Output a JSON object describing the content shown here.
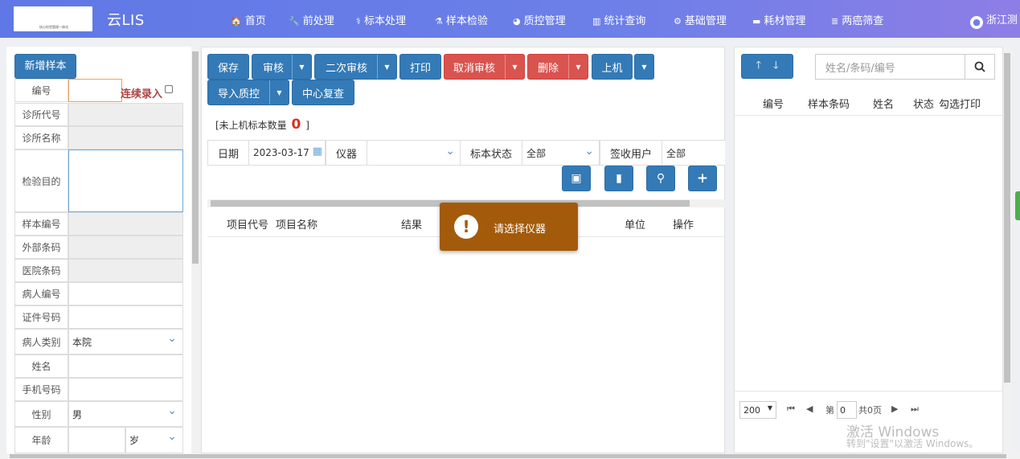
{
  "header": {
    "logo_text": "核心检验管理一体化",
    "app_title": "云LIS",
    "nav": [
      {
        "icon": "home-icon",
        "glyph": "🏠",
        "label": "首页"
      },
      {
        "icon": "wrench-icon",
        "glyph": "🔧",
        "label": "前处理"
      },
      {
        "icon": "stethoscope-icon",
        "glyph": "⚕",
        "label": "标本处理"
      },
      {
        "icon": "flask-icon",
        "glyph": "⚗",
        "label": "样本检验"
      },
      {
        "icon": "pie-chart-icon",
        "glyph": "◕",
        "label": "质控管理"
      },
      {
        "icon": "bar-chart-icon",
        "glyph": "▥",
        "label": "统计查询"
      },
      {
        "icon": "gear-icon",
        "glyph": "⚙",
        "label": "基础管理"
      },
      {
        "icon": "briefcase-icon",
        "glyph": "▬",
        "label": "耗材管理"
      },
      {
        "icon": "list-icon",
        "glyph": "≣",
        "label": "两癌筛查"
      }
    ],
    "user_label": "浙江测"
  },
  "left": {
    "new_sample": "新增样本",
    "continuous_entry": "连续录入",
    "fields": {
      "number": {
        "label": "编号",
        "value": ""
      },
      "clinic_code": {
        "label": "诊所代号",
        "value": ""
      },
      "clinic_name": {
        "label": "诊所名称",
        "value": ""
      },
      "purpose": {
        "label": "检验目的",
        "value": ""
      },
      "sample_no": {
        "label": "样本编号",
        "value": ""
      },
      "external_barcode": {
        "label": "外部条码",
        "value": ""
      },
      "hospital_barcode": {
        "label": "医院条码",
        "value": ""
      },
      "patient_no": {
        "label": "病人编号",
        "value": ""
      },
      "id_no": {
        "label": "证件号码",
        "value": ""
      },
      "patient_type": {
        "label": "病人类别",
        "value": "本院"
      },
      "name": {
        "label": "姓名",
        "value": ""
      },
      "phone": {
        "label": "手机号码",
        "value": ""
      },
      "gender": {
        "label": "性别",
        "value": "男"
      },
      "age": {
        "label": "年龄",
        "value": "",
        "unit": "岁"
      }
    }
  },
  "toolbar": {
    "save": "保存",
    "audit": "审核",
    "second_audit": "二次审核",
    "print": "打印",
    "cancel_audit": "取消审核",
    "delete": "删除",
    "upload": "上机",
    "import_qc": "导入质控",
    "center_review": "中心复查"
  },
  "unsent": {
    "prefix": "[未上机标本数量",
    "count": "0",
    "suffix": "]"
  },
  "filters": {
    "date_label": "日期",
    "date_value": "2023-03-17",
    "instrument_label": "仪器",
    "instrument_value": "",
    "status_label": "标本状态",
    "status_value": "全部",
    "receiver_label": "签收用户",
    "receiver_value": "全部"
  },
  "result_table": {
    "columns": [
      "项目代号",
      "项目名称",
      "结果",
      "单位",
      "操作"
    ]
  },
  "toast": {
    "message": "请选择仪器"
  },
  "right": {
    "search_placeholder": "姓名/条码/编号",
    "columns": [
      "编号",
      "样本条码",
      "姓名",
      "状态",
      "勾选打印"
    ],
    "page_size": "200",
    "page_prefix": "第",
    "page_value": "0",
    "page_total": "共0页"
  },
  "watermark": {
    "line1": "激活 Windows",
    "line2": "转到\"设置\"以激活 Windows。"
  },
  "colors": {
    "primary": "#337ab7",
    "danger": "#d9534f",
    "toast": "#a35b0b",
    "header": "#6d7fe8"
  }
}
